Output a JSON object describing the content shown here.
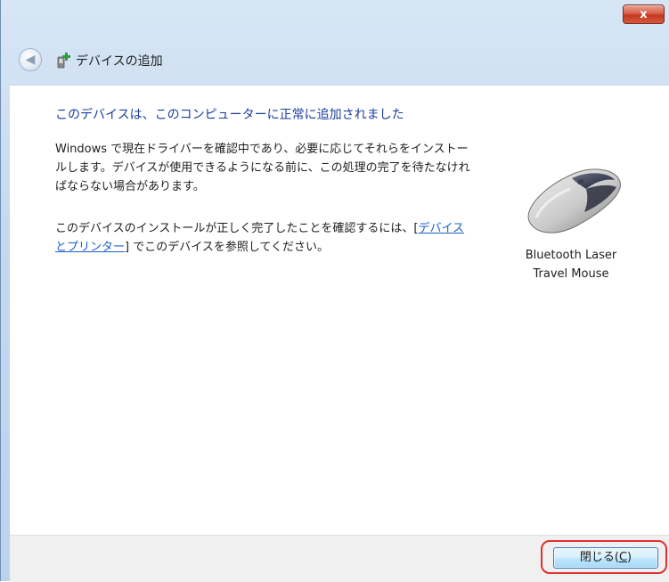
{
  "titlebar": {
    "close_glyph": "x"
  },
  "navbar": {
    "back_glyph": "◀",
    "icon": "device-add-icon",
    "title": "デバイスの追加"
  },
  "content": {
    "headline": "このデバイスは、このコンピューターに正常に追加されました",
    "para1": "Windows で現在ドライバーを確認中であり、必要に応じてそれらをインストールします。デバイスが使用できるようになる前に、この処理の完了を待たなければならない場合があります。",
    "para2_prefix": "このデバイスのインストールが正しく完了したことを確認するには、[",
    "para2_link": "デバイスとプリンター",
    "para2_suffix": "] でこのデバイスを参照してください。",
    "device_icon": "mouse-icon",
    "device_name_line1": "Bluetooth Laser",
    "device_name_line2": "Travel Mouse"
  },
  "footer": {
    "close_label": "閉じる(",
    "close_mnemonic": "C",
    "close_label_end": ")"
  },
  "colors": {
    "headline": "#1a3e9e",
    "link": "#1a5fc8",
    "highlight": "#e0312f",
    "titlebar_close": "#c2381f"
  }
}
